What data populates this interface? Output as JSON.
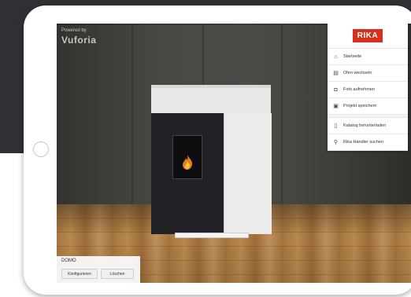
{
  "watermark": {
    "small": "Powered by",
    "big": "Vuforia"
  },
  "logo": {
    "text": "RIKA",
    "color": "#d6301e"
  },
  "menu": {
    "items": [
      {
        "label": "Startseite",
        "icon": "home-icon"
      },
      {
        "label": "Ofen wechseln",
        "icon": "stove-icon"
      },
      {
        "label": "Foto aufnehmen",
        "icon": "camera-icon"
      },
      {
        "label": "Projekt speichern",
        "icon": "save-icon"
      }
    ],
    "secondary": [
      {
        "label": "Katalog herunterladen",
        "icon": "catalog-icon"
      },
      {
        "label": "Rika Händler suchen",
        "icon": "location-pin-icon"
      }
    ]
  },
  "bottom_panel": {
    "title": "DOMO",
    "configure_label": "Konfigurieren",
    "delete_label": "Löschen"
  }
}
